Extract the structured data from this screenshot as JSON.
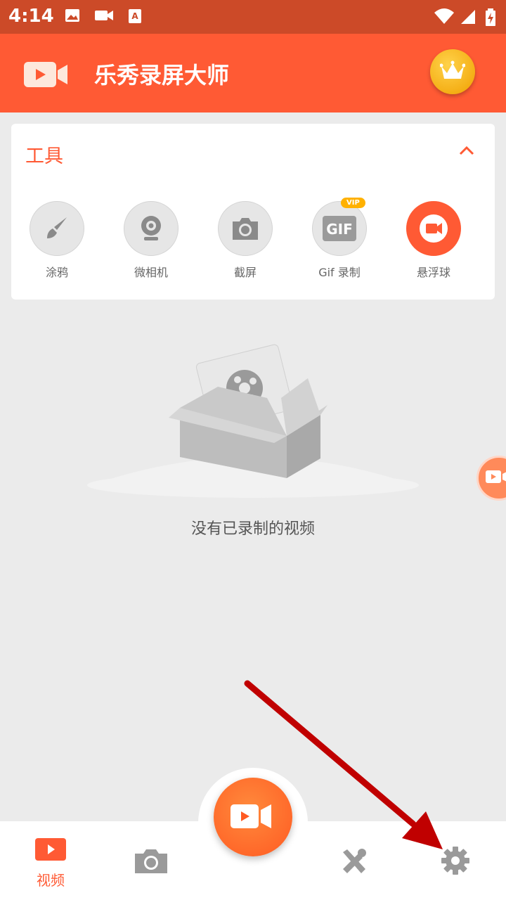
{
  "status_bar": {
    "time": "4:14",
    "icons": [
      "image-icon",
      "video-icon",
      "text-icon",
      "wifi-icon",
      "signal-icon",
      "battery-charging-icon"
    ]
  },
  "app_bar": {
    "title": "乐秀录屏大师",
    "logo_icon": "video-camera-logo-icon",
    "vip_icon": "crown-icon"
  },
  "tools": {
    "title": "工具",
    "collapse_icon": "chevron-up-icon",
    "items": [
      {
        "label": "涂鸦",
        "icon": "brush-icon"
      },
      {
        "label": "微相机",
        "icon": "webcam-icon"
      },
      {
        "label": "截屏",
        "icon": "camera-icon"
      },
      {
        "label": "Gif 录制",
        "icon": "gif-icon",
        "badge": "VIP"
      },
      {
        "label": "悬浮球",
        "icon": "floating-record-icon"
      }
    ]
  },
  "empty_state": {
    "illustration": "empty-box-film-icon",
    "text": "没有已录制的视频"
  },
  "bottom_nav": {
    "items": [
      {
        "label": "视频",
        "icon": "video-tab-icon",
        "active": true
      },
      {
        "label": "",
        "icon": "camera-tab-icon"
      },
      {
        "label": "",
        "icon": "record-fab-icon"
      },
      {
        "label": "",
        "icon": "tools-tab-icon"
      },
      {
        "label": "",
        "icon": "settings-gear-icon"
      }
    ]
  },
  "colors": {
    "accent": "#ff5a34",
    "status_bar": "#cc4a28",
    "background": "#ebebeb",
    "annotation_arrow": "#c00000"
  }
}
